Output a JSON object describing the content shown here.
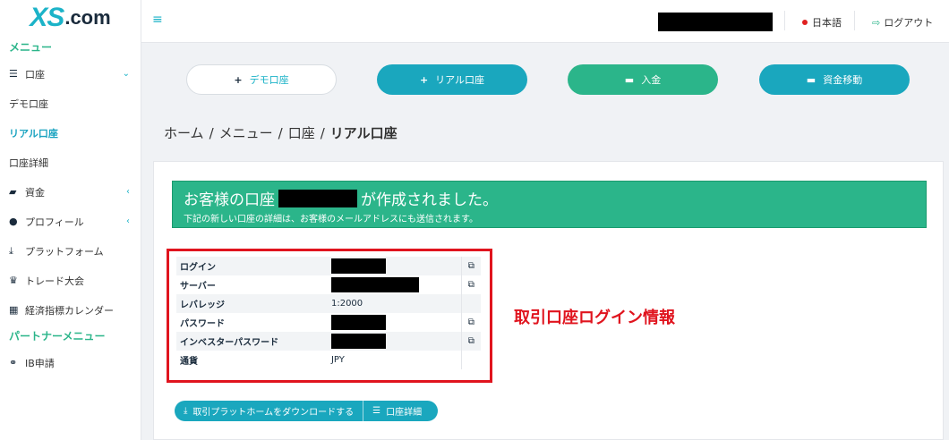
{
  "logo": {
    "brand": "XS",
    "suffix": ".com"
  },
  "sidebar": {
    "menu_header": "メニュー",
    "items": [
      {
        "label": "口座",
        "icon": "list-icon"
      },
      {
        "label": "デモ口座"
      },
      {
        "label": "リアル口座"
      },
      {
        "label": "口座詳細"
      },
      {
        "label": "資金",
        "icon": "wallet-icon"
      },
      {
        "label": "プロフィール",
        "icon": "user-icon"
      },
      {
        "label": "プラットフォーム",
        "icon": "download-icon"
      },
      {
        "label": "トレード大会",
        "icon": "trophy-icon"
      },
      {
        "label": "経済指標カレンダー",
        "icon": "calendar-icon"
      }
    ],
    "partner_header": "パートナーメニュー",
    "partner_items": [
      {
        "label": "IB申請",
        "icon": "handshake-icon"
      }
    ]
  },
  "topbar": {
    "language": "日本語",
    "logout": "ログアウト"
  },
  "actions": {
    "demo": "デモ口座",
    "real": "リアル口座",
    "deposit": "入金",
    "transfer": "資金移動"
  },
  "breadcrumb": {
    "home": "ホーム",
    "menu": "メニュー",
    "account": "口座",
    "current": "リアル口座"
  },
  "banner": {
    "title_prefix": "お客様の口座",
    "title_suffix": "が作成されました。",
    "subtitle": "下記の新しい口座の詳細は、お客様のメールアドレスにも送信されます。"
  },
  "account_info": {
    "rows": [
      {
        "label": "ログイン",
        "value": "",
        "redacted": true
      },
      {
        "label": "サーバー",
        "value": "",
        "redacted": true
      },
      {
        "label": "レバレッジ",
        "value": "1:2000",
        "redacted": false
      },
      {
        "label": "パスワード",
        "value": "",
        "redacted": true
      },
      {
        "label": "インベスターパスワード",
        "value": "",
        "redacted": true
      },
      {
        "label": "通貨",
        "value": "JPY",
        "redacted": false
      }
    ]
  },
  "annotation": "取引口座ログイン情報",
  "bottom_actions": {
    "download": "取引プラットホームをダウンロードする",
    "details": "口座詳細"
  },
  "colors": {
    "primary": "#1aa7be",
    "success": "#2bb58a",
    "annotation_red": "#e0141e"
  }
}
